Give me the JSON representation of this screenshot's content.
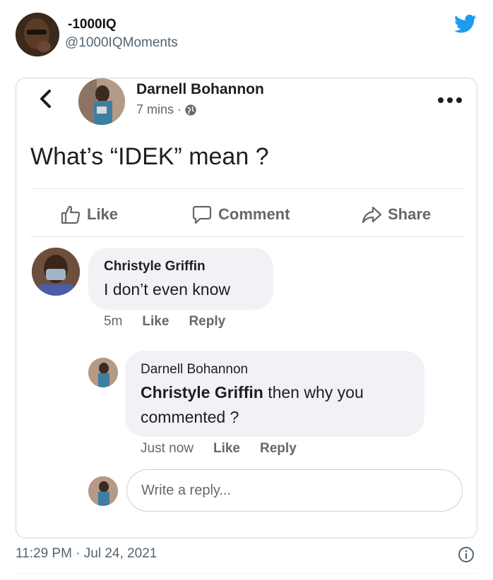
{
  "tweet": {
    "display_name": "-1000IQ",
    "handle": "@1000IQMoments",
    "timestamp": "11:29 PM · Jul 24, 2021",
    "brand_color": "#1d9bf0"
  },
  "post": {
    "author": "Darnell Bohannon",
    "time": "7 mins ·",
    "text": "What’s “IDEK” mean ?",
    "actions": {
      "like": "Like",
      "comment": "Comment",
      "share": "Share"
    }
  },
  "comments": [
    {
      "author": "Christyle Griffin",
      "text": "I don’t even know",
      "time": "5m",
      "like": "Like",
      "reply": "Reply"
    },
    {
      "author": "Darnell Bohannon",
      "mention": "Christyle Griffin",
      "text_line1": " then why you",
      "text_line2": "commented ?",
      "time": "Just now",
      "like": "Like",
      "reply": "Reply"
    }
  ],
  "reply_box": {
    "placeholder": "Write a reply..."
  }
}
